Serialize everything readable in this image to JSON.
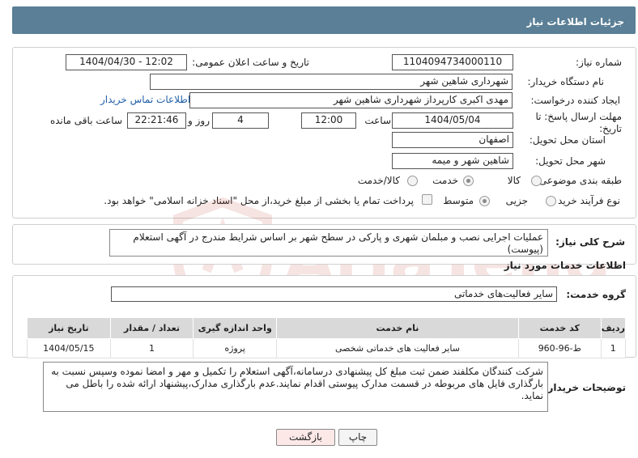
{
  "header": {
    "title": "جزئیات اطلاعات نیاز"
  },
  "form": {
    "need_number_label": "شماره نیاز:",
    "need_number": "1104094734000110",
    "announce_label": "تاریخ و ساعت اعلان عمومی:",
    "announce_value": "1404/04/30 - 12:02",
    "buyer_org_label": "نام دستگاه خریدار:",
    "buyer_org": "شهرداری شاهین شهر",
    "creator_label": "ایجاد کننده درخواست:",
    "creator": "مهدی اکبری کارپرداز شهرداری شاهین شهر",
    "contact_link": "اطلاعات تماس خریدار",
    "deadline_label": "مهلت ارسال پاسخ: تا تاریخ:",
    "deadline_date": "1404/05/04",
    "time_label": "ساعت",
    "deadline_time": "12:00",
    "days_value": "4",
    "days_label": "روز و",
    "remaining_time": "22:21:46",
    "remaining_label": "ساعت باقی مانده",
    "province_label": "استان محل تحویل:",
    "province": "اصفهان",
    "city_label": "شهر محل تحویل:",
    "city": "شاهین شهر و میمه",
    "category_label": "طبقه بندی موضوعی:",
    "category_options": [
      "کالا",
      "خدمت",
      "کالا/خدمت"
    ],
    "category_selected": "خدمت",
    "process_label": "نوع فرآیند خرید :",
    "process_options": [
      "جزیی",
      "متوسط"
    ],
    "process_selected": "جزیی",
    "payment_note": "پرداخت تمام یا بخشی از مبلغ خرید،از محل \"اسناد خزانه اسلامی\" خواهد بود."
  },
  "summary": {
    "label": "شرح کلی نیاز:",
    "text": "عملیات اجرایی نصب و مبلمان شهری و پارکی در سطح شهر بر اساس شرایط مندرج در آگهی استعلام (پیوست)"
  },
  "services": {
    "section_title": "اطلاعات خدمات مورد نیاز",
    "group_label": "گروه خدمت:",
    "group_value": "سایر فعالیت‌های خدماتی",
    "columns": [
      "ردیف",
      "کد خدمت",
      "نام خدمت",
      "واحد اندازه گیری",
      "تعداد / مقدار",
      "تاریخ نیاز"
    ],
    "rows": [
      {
        "row": "1",
        "code": "ط-96-960",
        "name": "سایر فعالیت های خدماتی شخصی",
        "unit": "پروژه",
        "qty": "1",
        "date": "1404/05/15"
      }
    ]
  },
  "buyer_notes": {
    "label": "توضیحات خریدار:",
    "text": "شرکت کنندگان مکلفند ضمن ثبت مبلغ کل پیشنهادی درسامانه،آگهی استعلام را  تکمیل و مهر و امضا نموده وسپس نسبت به بارگذاری فایل های مربوطه در قسمت مدارک پیوستی اقدام نمایند.عدم بارگذاری مدارک،پیشنهاد ارائه شده را باطل می نماید."
  },
  "buttons": {
    "print": "چاپ",
    "back": "بازگشت"
  },
  "watermark": {
    "text": "AriaTender.net"
  },
  "colors": {
    "header_bg": "#5a7f96",
    "link": "#1f5fa8",
    "back_button_bg": "#fde8e8",
    "watermark": "#c0392b"
  }
}
